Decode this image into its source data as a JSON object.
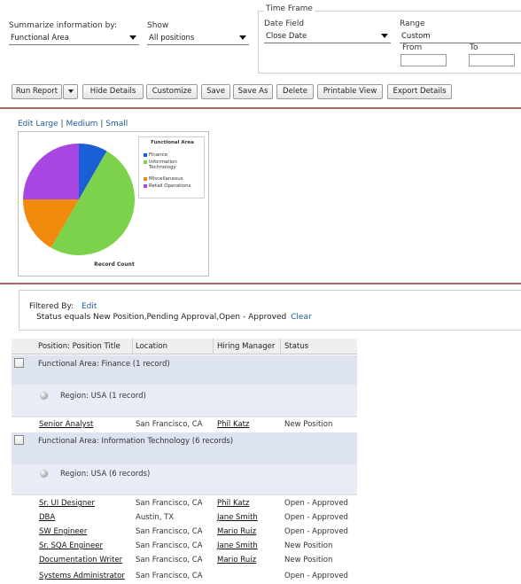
{
  "filters": {
    "summarize_label": "Summarize information by:",
    "summarize_value": "Functional Area",
    "show_label": "Show",
    "show_value": "All positions",
    "timeframe_label": "Time Frame",
    "date_field_label": "Date Field",
    "date_field_value": "Close Date",
    "range_label": "Range",
    "range_value": "Custom",
    "from_label": "From",
    "to_label": "To",
    "from_value": "",
    "to_value": ""
  },
  "toolbar": {
    "run_report": "Run Report",
    "hide_details": "Hide Details",
    "customize": "Customize",
    "save": "Save",
    "save_as": "Save As",
    "delete": "Delete",
    "printable_view": "Printable View",
    "export_details": "Export Details"
  },
  "chart_links": {
    "edit": "Edit",
    "large": "Large",
    "medium": "Medium",
    "small": "Small",
    "sep": "|"
  },
  "chart_data": {
    "type": "pie",
    "title": "Record Count",
    "legend_title": "Functional Area",
    "legend_position": "right",
    "categories": [
      "Finance",
      "Information Technology",
      "Miscellaneous",
      "Retail Operations"
    ],
    "values": [
      1,
      6,
      2,
      3
    ],
    "colors": [
      "#1a5fd6",
      "#7cd24a",
      "#f08a0d",
      "#a746e0"
    ]
  },
  "filter_info": {
    "filtered_by": "Filtered By:",
    "edit": "Edit",
    "criteria": "Status equals New Position,Pending Approval,Open - Approved",
    "clear": "Clear"
  },
  "table": {
    "headers": [
      "Position: Position Title",
      "Location",
      "Hiring Manager",
      "Status"
    ],
    "groups": [
      {
        "label": "Functional Area: Finance (1 record)",
        "region": "Region: USA (1 record)",
        "rows": [
          [
            "Senior Analyst",
            "San Francisco, CA",
            "Phil Katz",
            "New Position"
          ]
        ]
      },
      {
        "label": "Functional Area: Information Technology (6 records)",
        "region": "Region: USA (6 records)",
        "rows": [
          [
            "Sr. UI Designer",
            "San Francisco, CA",
            "Phil Katz",
            "Open - Approved"
          ],
          [
            "DBA",
            "Austin, TX",
            "Jane Smith",
            "Open - Approved"
          ],
          [
            "SW Engineer",
            "San Francisco, CA",
            "Mario Ruiz",
            "Open - Approved"
          ],
          [
            "Sr. SQA Engineer",
            "San Francisco, CA",
            "Jane Smith",
            "New Position"
          ],
          [
            "Documentation Writer",
            "San Francisco, CA",
            "Mario Ruiz",
            "New Position"
          ],
          [
            "Systems Administrator",
            "San Francisco, CA",
            "",
            "Open - Approved"
          ]
        ]
      }
    ]
  }
}
